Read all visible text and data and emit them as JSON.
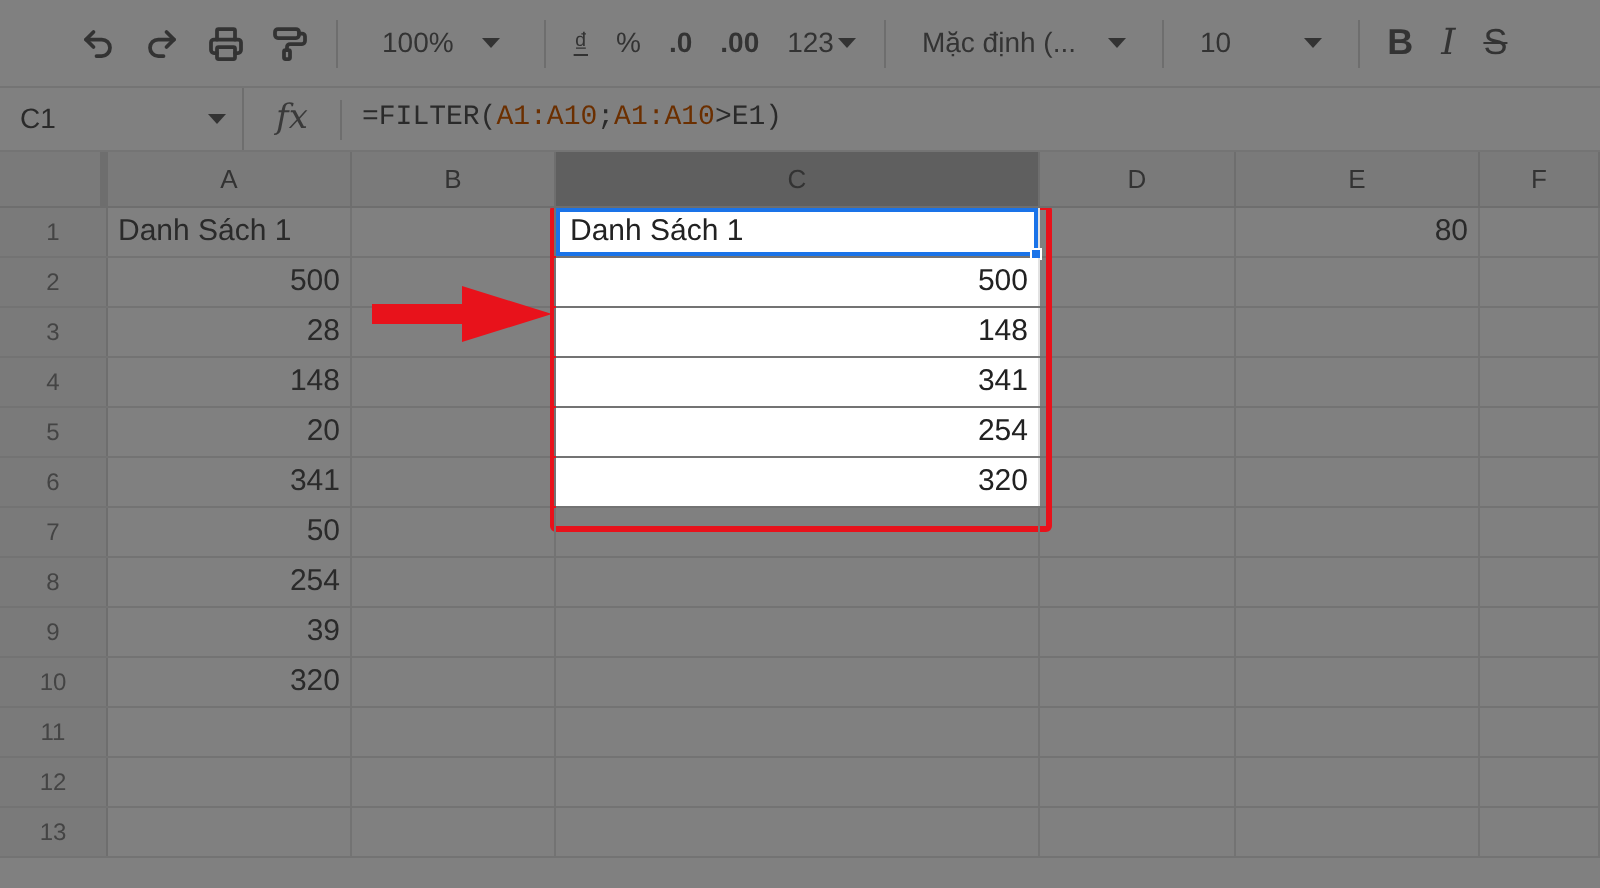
{
  "toolbar": {
    "zoom": "100%",
    "currency": "₫",
    "percent": "%",
    "decrease_decimals": ".0",
    "increase_decimals": ".00",
    "more_formats": "123",
    "font": "Mặc định (...",
    "font_size": "10",
    "bold": "B",
    "italic": "I",
    "strikethrough": "S"
  },
  "formula_bar": {
    "name_box": "C1",
    "fx": "fx",
    "formula_parts": [
      {
        "text": "=FILTER(",
        "kind": "plain"
      },
      {
        "text": "A1:A10",
        "kind": "range"
      },
      {
        "text": ";",
        "kind": "plain"
      },
      {
        "text": "A1:A10",
        "kind": "range"
      },
      {
        "text": ">E1)",
        "kind": "plain"
      }
    ]
  },
  "columns": [
    {
      "label": "A",
      "selected": false
    },
    {
      "label": "B",
      "selected": false
    },
    {
      "label": "C",
      "selected": true
    },
    {
      "label": "D",
      "selected": false
    },
    {
      "label": "E",
      "selected": false
    },
    {
      "label": "F",
      "selected": false
    }
  ],
  "rows": [
    {
      "number": "1",
      "spotlight": true,
      "cells": {
        "A": {
          "text": "Danh Sách 1",
          "kind": "text",
          "active": false
        },
        "C": {
          "text": "Danh Sách 1",
          "kind": "text",
          "active": true
        },
        "E": {
          "text": "80",
          "kind": "number",
          "active": false
        }
      }
    },
    {
      "number": "2",
      "spotlight": true,
      "cells": {
        "A": {
          "text": "500",
          "kind": "number",
          "active": false
        },
        "C": {
          "text": "500",
          "kind": "number",
          "active": false
        }
      }
    },
    {
      "number": "3",
      "spotlight": true,
      "cells": {
        "A": {
          "text": "28",
          "kind": "number",
          "active": false
        },
        "C": {
          "text": "148",
          "kind": "number",
          "active": false
        }
      }
    },
    {
      "number": "4",
      "spotlight": true,
      "cells": {
        "A": {
          "text": "148",
          "kind": "number",
          "active": false
        },
        "C": {
          "text": "341",
          "kind": "number",
          "active": false
        }
      }
    },
    {
      "number": "5",
      "spotlight": true,
      "cells": {
        "A": {
          "text": "20",
          "kind": "number",
          "active": false
        },
        "C": {
          "text": "254",
          "kind": "number",
          "active": false
        }
      }
    },
    {
      "number": "6",
      "spotlight": true,
      "cells": {
        "A": {
          "text": "341",
          "kind": "number",
          "active": false
        },
        "C": {
          "text": "320",
          "kind": "number",
          "active": false
        }
      }
    },
    {
      "number": "7",
      "spotlight": false,
      "cells": {
        "A": {
          "text": "50",
          "kind": "number",
          "active": false
        }
      }
    },
    {
      "number": "8",
      "spotlight": false,
      "cells": {
        "A": {
          "text": "254",
          "kind": "number",
          "active": false
        }
      }
    },
    {
      "number": "9",
      "spotlight": false,
      "cells": {
        "A": {
          "text": "39",
          "kind": "number",
          "active": false
        }
      }
    },
    {
      "number": "10",
      "spotlight": false,
      "cells": {
        "A": {
          "text": "320",
          "kind": "number",
          "active": false
        }
      }
    },
    {
      "number": "11",
      "spotlight": false
    },
    {
      "number": "12",
      "spotlight": false
    },
    {
      "number": "13",
      "spotlight": false
    }
  ]
}
